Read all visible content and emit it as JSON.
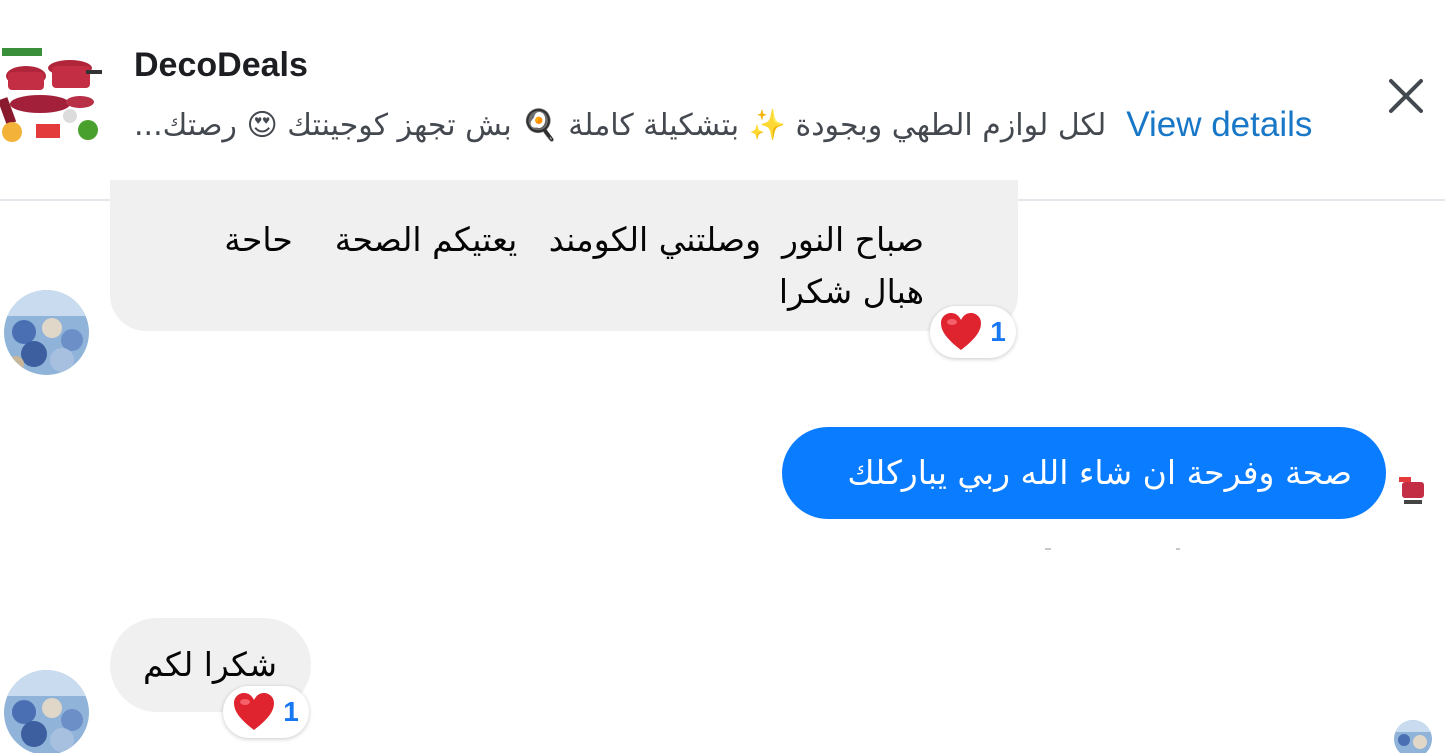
{
  "header": {
    "shop_name": "DecoDeals",
    "preview_text": "لكل لوازم الطهي وبجودة ✨ بتشكيلة كاملة 🍳 بش تجهز كوجينتك 😍 رصتك...",
    "view_details_label": "View details"
  },
  "messages": [
    {
      "direction": "incoming",
      "lines": [
        "صباح النور  وصلتني الكومند   يعتيكم الصحة    حاحة",
        "هبال شكرا"
      ],
      "reaction": {
        "emoji": "❤️",
        "count": "1"
      }
    },
    {
      "direction": "outgoing",
      "text": "صحة وفرحة ان شاء الله ربي يباركلك"
    },
    {
      "direction": "incoming",
      "text": "شكرا لكم",
      "reaction": {
        "emoji": "❤️",
        "count": "1"
      }
    }
  ],
  "colors": {
    "outgoing_bubble": "#0a7cff",
    "incoming_bubble": "#f0f0f0",
    "link": "#1877c6",
    "reaction_count": "#1877f2"
  },
  "icons": [
    "close-icon",
    "heart-icon",
    "shop-logo",
    "user-avatar"
  ]
}
